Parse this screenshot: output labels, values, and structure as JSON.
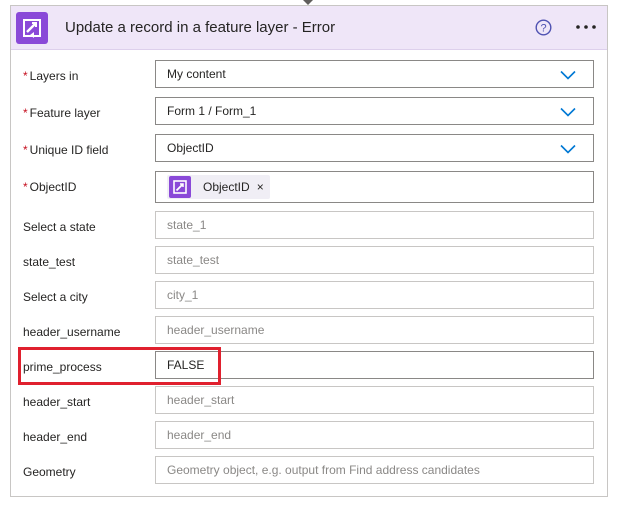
{
  "card": {
    "title": "Update a record in a feature layer - Error",
    "icon": "arcgis-connector-icon",
    "actions": [
      "help-icon",
      "more-options-icon"
    ],
    "accent_color": "#8a49d8",
    "header_color": "#efe6f8"
  },
  "fields": [
    {
      "label": "Layers in",
      "required": true,
      "value": "My content",
      "type": "dropdown"
    },
    {
      "label": "Feature layer",
      "required": true,
      "value": "Form 1 / Form_1",
      "type": "dropdown"
    },
    {
      "label": "Unique ID field",
      "required": true,
      "value": "ObjectID",
      "type": "dropdown"
    },
    {
      "label": "ObjectID",
      "required": true,
      "token": "ObjectID",
      "token_remove": "×",
      "type": "token"
    },
    {
      "label": "Select a state",
      "placeholder": "state_1",
      "type": "text"
    },
    {
      "label": "state_test",
      "placeholder": "state_test",
      "type": "text"
    },
    {
      "label": "Select a city",
      "placeholder": "city_1",
      "type": "text"
    },
    {
      "label": "header_username",
      "placeholder": "header_username",
      "type": "text"
    },
    {
      "label": "prime_process",
      "value": "FALSE",
      "type": "text",
      "highlighted": true
    },
    {
      "label": "header_start",
      "placeholder": "header_start",
      "type": "text"
    },
    {
      "label": "header_end",
      "placeholder": "header_end",
      "type": "text"
    },
    {
      "label": "Geometry",
      "placeholder": "Geometry object, e.g. output from Find address candidates",
      "type": "text"
    }
  ],
  "required_marker": "*",
  "highlight_color": "#e0202e"
}
